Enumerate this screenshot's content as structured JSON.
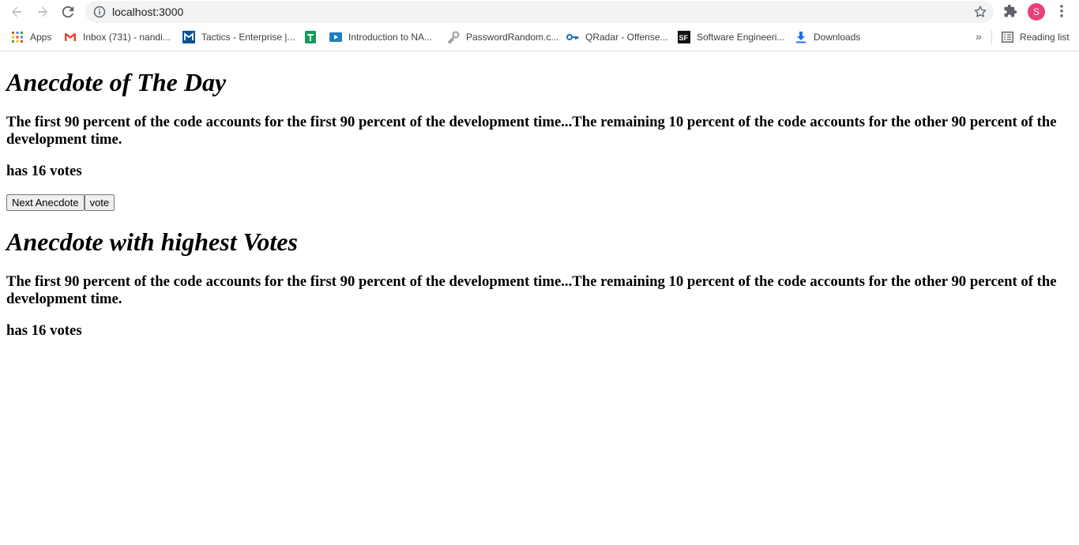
{
  "browser": {
    "url": "localhost:3000",
    "profile_initial": "S",
    "bookmarks": [
      {
        "label": "Apps",
        "icon": "apps-grid-icon"
      },
      {
        "label": "Inbox (731) - nandi...",
        "icon": "gmail-icon"
      },
      {
        "label": "Tactics - Enterprise |...",
        "icon": "mitre-icon"
      },
      {
        "label": "",
        "icon": "sheets-icon"
      },
      {
        "label": "Introduction to NA...",
        "icon": "video-icon"
      },
      {
        "label": "PasswordRandom.c...",
        "icon": "key-icon"
      },
      {
        "label": "QRadar - Offense...",
        "icon": "qradar-key-icon"
      },
      {
        "label": "Software Engineeri...",
        "icon": "sf-icon"
      },
      {
        "label": "Downloads",
        "icon": "download-icon"
      }
    ],
    "overflow": "»",
    "reading_list": "Reading list"
  },
  "page": {
    "day_heading": "Anecdote of The Day",
    "day_anecdote": "The first 90 percent of the code accounts for the first 90 percent of the development time...The remaining 10 percent of the code accounts for the other 90 percent of the development time.",
    "day_votes": "has 16 votes",
    "next_button": "Next Anecdote",
    "vote_button": "vote",
    "top_heading": "Anecdote with highest Votes",
    "top_anecdote": "The first 90 percent of the code accounts for the first 90 percent of the development time...The remaining 10 percent of the code accounts for the other 90 percent of the development time.",
    "top_votes": "has 16 votes"
  }
}
